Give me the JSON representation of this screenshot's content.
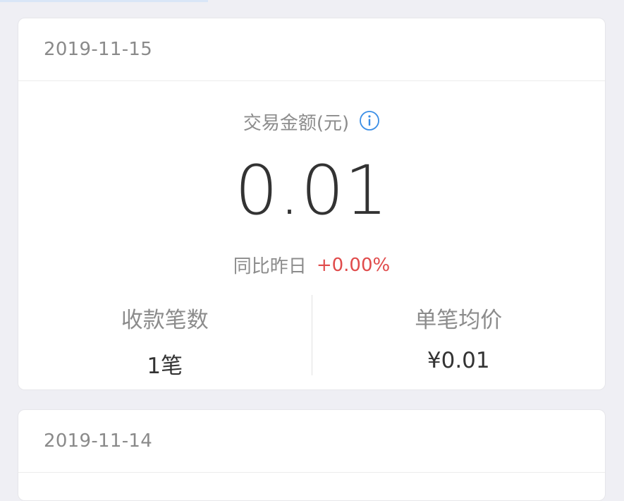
{
  "cards": [
    {
      "date": "2019-11-15",
      "amount_label": "交易金额(元)",
      "info_icon": "info-icon",
      "amount_value": "0.01",
      "compare_label": "同比昨日",
      "compare_value": "+0.00%",
      "stats": [
        {
          "label": "收款笔数",
          "value": "1笔"
        },
        {
          "label": "单笔均价",
          "value": "¥0.01"
        }
      ]
    },
    {
      "date": "2019-11-14"
    }
  ],
  "colors": {
    "background": "#efeff4",
    "card": "#ffffff",
    "muted_text": "#8c8c8c",
    "primary_text": "#333333",
    "positive_change": "#e04b4b",
    "info_blue": "#3a8ee6"
  }
}
